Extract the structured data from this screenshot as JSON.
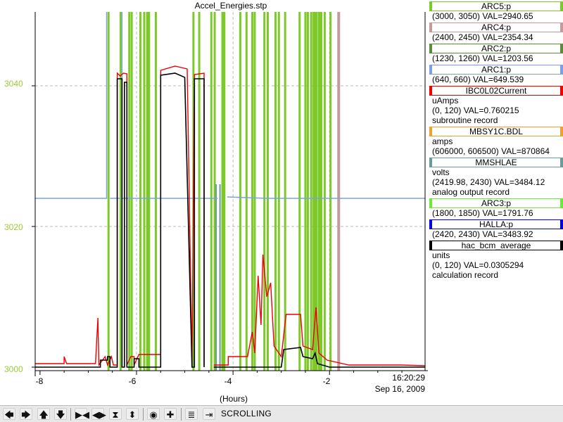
{
  "chart_data": {
    "type": "line",
    "title": "Accel_Energies.stp",
    "xlabel": "(Hours)",
    "xlim": [
      -8.1,
      -0.02
    ],
    "ylim": [
      2999.5,
      3050.5
    ],
    "x_ticks": [
      "-8",
      "-6",
      "-4",
      "-2"
    ],
    "y_ticks": [
      "3000",
      "3020",
      "3040"
    ],
    "y_tick_color": "#9acd32",
    "end_time": "16:20:29",
    "end_date": "Sep 16, 2009",
    "grid": true,
    "series": [
      {
        "name": "ARC1:p",
        "color": "#7ba0e8",
        "segments": [
          [
            [
              -8.1,
              3024.0
            ],
            [
              -6.62,
              3024.0
            ],
            [
              -6.62,
              3050.5
            ]
          ],
          [
            [
              -6.55,
              3024.0
            ],
            [
              -6.3,
              3024.0
            ],
            [
              -6.3,
              3050.5
            ]
          ],
          [
            [
              -6.3,
              3024.0
            ],
            [
              -4.32,
              3024.0
            ]
          ],
          [
            [
              -4.12,
              3024.2
            ],
            [
              -3.3,
              3024.0
            ],
            [
              -2.0,
              3024.0
            ],
            [
              -0.02,
              3024.0
            ]
          ]
        ]
      },
      {
        "name": "IBC0L02Current",
        "color": "#ee0000",
        "segments": [
          [
            [
              -8.1,
              3000.5
            ],
            [
              -7.5,
              3000.5
            ],
            [
              -7.5,
              3001.5
            ],
            [
              -7.45,
              3000.5
            ],
            [
              -6.85,
              3000.5
            ],
            [
              -6.8,
              3007.0
            ],
            [
              -6.78,
              3000.3
            ],
            [
              -6.65,
              3001.5
            ],
            [
              -6.6,
              3000.3
            ],
            [
              -6.52,
              3001.5
            ],
            [
              -6.48,
              3000.3
            ],
            [
              -6.4,
              3000.3
            ],
            [
              -6.4,
              3041.8
            ],
            [
              -6.34,
              3041.4
            ],
            [
              -6.27,
              3041.8
            ],
            [
              -6.2,
              3041.7
            ],
            [
              -6.2,
              3000.3
            ],
            [
              -6.12,
              3001.5
            ],
            [
              -6.05,
              3001.5
            ],
            [
              -6.05,
              3000.3
            ],
            [
              -5.95,
              3001.8
            ],
            [
              -5.5,
              3001.8
            ],
            [
              -5.5,
              3042.2
            ],
            [
              -5.2,
              3042.8
            ],
            [
              -4.95,
              3042.4
            ],
            [
              -4.85,
              3000.3
            ],
            [
              -4.8,
              3041.6
            ],
            [
              -4.6,
              3041.8
            ],
            [
              -4.6,
              3000.2
            ]
          ],
          [
            [
              -4.4,
              3000.3
            ],
            [
              -4.1,
              3000.3
            ],
            [
              -4.1,
              3001.5
            ],
            [
              -3.7,
              3001.5
            ],
            [
              -3.6,
              3005.0
            ],
            [
              -3.55,
              3002.0
            ],
            [
              -3.48,
              3013.0
            ],
            [
              -3.42,
              3006.0
            ],
            [
              -3.38,
              3016.0
            ],
            [
              -3.3,
              3010.0
            ],
            [
              -3.22,
              3012.0
            ],
            [
              -3.15,
              3003.0
            ],
            [
              -3.0,
              3001.5
            ],
            [
              -2.9,
              3007.5
            ],
            [
              -2.6,
              3007.5
            ],
            [
              -2.55,
              3003.0
            ],
            [
              -2.35,
              3002.5
            ],
            [
              -2.28,
              3008.5
            ],
            [
              -2.22,
              3002.0
            ],
            [
              -2.05,
              3001.0
            ],
            [
              -1.6,
              3000.3
            ],
            [
              -0.5,
              3000.3
            ],
            [
              -0.02,
              3000.2
            ]
          ]
        ]
      },
      {
        "name": "hac_bcm_average",
        "color": "#000000",
        "segments": [
          [
            [
              -8.1,
              3000.0
            ],
            [
              -6.75,
              3000.0
            ],
            [
              -6.75,
              3001.0
            ],
            [
              -6.6,
              3001.0
            ],
            [
              -6.6,
              3001.5
            ],
            [
              -6.55,
              3001.5
            ],
            [
              -6.55,
              3000.0
            ],
            [
              -6.4,
              3000.0
            ],
            [
              -6.4,
              3041.0
            ],
            [
              -6.3,
              3041.0
            ],
            [
              -6.3,
              3000.0
            ],
            [
              -6.25,
              3000.0
            ],
            [
              -6.25,
              3040.5
            ],
            [
              -6.2,
              3040.5
            ],
            [
              -6.2,
              3000.0
            ],
            [
              -6.05,
              3000.0
            ],
            [
              -6.05,
              3001.2
            ],
            [
              -5.95,
              3001.2
            ],
            [
              -5.95,
              3000.0
            ],
            [
              -5.5,
              3000.0
            ],
            [
              -5.5,
              3041.5
            ],
            [
              -5.2,
              3041.8
            ],
            [
              -5.0,
              3041.2
            ],
            [
              -4.85,
              3000.0
            ],
            [
              -4.8,
              3000.0
            ],
            [
              -4.8,
              3041.0
            ],
            [
              -4.6,
              3041.0
            ],
            [
              -4.6,
              3000.0
            ]
          ],
          [
            [
              -4.4,
              3000.0
            ],
            [
              -3.0,
              3000.0
            ],
            [
              -2.95,
              3002.5
            ],
            [
              -2.6,
              3002.8
            ],
            [
              -2.55,
              3001.5
            ],
            [
              -2.35,
              3001.2
            ],
            [
              -2.3,
              3002.0
            ],
            [
              -2.25,
              3000.5
            ],
            [
              -2.0,
              3000.0
            ],
            [
              -0.02,
              3000.0
            ]
          ]
        ]
      }
    ],
    "green_markers": [
      -6.58,
      -6.33,
      -6.15,
      -6.1,
      -5.92,
      -5.84,
      -5.78,
      -5.74,
      -5.6,
      -4.82,
      -4.7,
      -4.45,
      -4.38,
      -4.22,
      -4.18,
      -3.85,
      -3.72,
      -3.6,
      -3.55,
      -3.35,
      -3.28,
      -3.12,
      -3.05,
      -2.92,
      -2.62,
      -2.5,
      -2.45,
      -2.38,
      -2.33,
      -2.3,
      -2.27,
      -2.22,
      -2.19,
      -2.17,
      -2.1,
      -1.98
    ],
    "brown_markers": [
      -1.81
    ],
    "teal_markers": [
      -4.35,
      -4.27
    ],
    "legend": [
      {
        "name": "ARC5:p",
        "color": "#7dc929",
        "lines": [
          "(3000, 3050) VAL=2940.65"
        ]
      },
      {
        "name": "ARC4:p",
        "color": "#c49a9a",
        "lines": [
          "(2400, 2450) VAL=2354.34"
        ]
      },
      {
        "name": "ARC2:p",
        "color": "#5e8a3e",
        "lines": [
          "(1230, 1260) VAL=1203.56"
        ]
      },
      {
        "name": "ARC1:p",
        "color": "#7ba0e8",
        "lines": [
          "(640, 660) VAL=649.539"
        ]
      },
      {
        "name": "IBC0L02Current",
        "color": "#ee0000",
        "lines": [
          "uAmps",
          "(0, 120) VAL=0.760215",
          "subroutine record"
        ]
      },
      {
        "name": "MBSY1C.BDL",
        "color": "#f0a030",
        "lines": [
          "amps",
          "(606000, 606500)  VAL=870864"
        ]
      },
      {
        "name": "MMSHLAE",
        "color": "#6a9a9a",
        "lines": [
          "volts",
          "(2419.98, 2430)  VAL=3484.12",
          "analog output record"
        ]
      },
      {
        "name": "ARC3:p",
        "color": "#6de83a",
        "lines": [
          "(1800, 1850) VAL=1791.76"
        ]
      },
      {
        "name": "HALLA:p",
        "color": "#0000d8",
        "lines": [
          "(2420, 2430) VAL=3483.92"
        ]
      },
      {
        "name": "hac_bcm_average",
        "color": "#000000",
        "lines": [
          "units",
          "(0, 120) VAL=0.0305294",
          "calculation record"
        ]
      }
    ]
  },
  "toolbar": {
    "mode": "SCROLLING",
    "buttons": [
      "arrow-left-icon",
      "arrow-right-icon",
      "arrow-up-icon",
      "arrow-down-icon",
      "compress-horizontal-icon",
      "expand-horizontal-icon",
      "compress-vertical-icon",
      "expand-vertical-icon",
      "record-icon",
      "crosshair-icon",
      "overlay-icon",
      "goto-end-icon"
    ]
  }
}
